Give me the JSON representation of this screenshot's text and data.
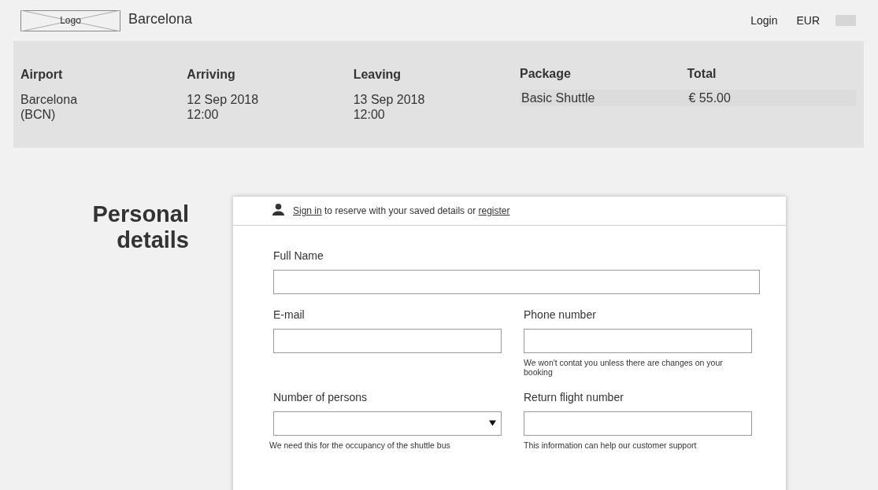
{
  "header": {
    "logo": "Logo",
    "site_title": "Barcelona",
    "login": "Login",
    "currency": "EUR"
  },
  "summary": {
    "columns": [
      {
        "heading": "Airport",
        "lines": [
          "Barcelona",
          "(BCN)"
        ]
      },
      {
        "heading": "Arriving",
        "lines": [
          "12 Sep 2018",
          "12:00"
        ]
      },
      {
        "heading": "Leaving",
        "lines": [
          "13 Sep 2018",
          "12:00"
        ]
      }
    ],
    "package": {
      "heading": "Package",
      "value": "Basic Shuttle"
    },
    "total": {
      "heading": "Total",
      "value": "€ 55.00"
    }
  },
  "section_title": "Personal details",
  "signin": {
    "link": "Sign in",
    "text": "to reserve with your saved details or",
    "register": "register"
  },
  "fields": [
    {
      "kind": "text",
      "label": "Full Name",
      "wide": true
    },
    {
      "kind": "text",
      "label": "E-mail",
      "wide": false
    },
    {
      "kind": "text",
      "label": "Phone number",
      "wide": false,
      "hint": "We won't contat you unless there are changes on your booking"
    },
    {
      "kind": "select",
      "label": "Number of persons",
      "wide": false,
      "hint": "We need this for the occupancy of the shuttle bus"
    },
    {
      "kind": "text",
      "label": "Return flight number",
      "wide": false,
      "hint": "This information can help our customer support"
    }
  ]
}
